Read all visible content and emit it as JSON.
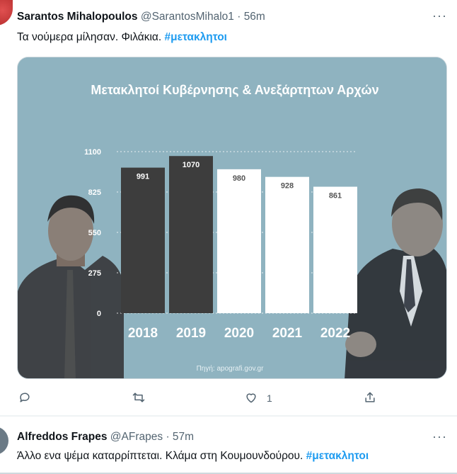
{
  "tweet1": {
    "author": "Sarantos Mihalopoulos",
    "handle": "@SarantosMihalo1",
    "separator": "·",
    "time": "56m",
    "text": "Τα νούμερα μίλησαν. Φιλάκια.",
    "hashtag": "#μετακλητοι",
    "more": "···",
    "likes": "1",
    "icons": [
      "reply-icon",
      "retweet-icon",
      "like-icon",
      "share-icon"
    ]
  },
  "tweet2": {
    "author": "Alfreddos Frapes",
    "handle": "@AFrapes",
    "separator": "·",
    "time": "57m",
    "text": "Άλλο ενα ψέμα καταρρίπτεται. Κλάμα στη Κουμουνδούρου.",
    "hashtag": "#μετακλητοι",
    "more": "···"
  },
  "colors": {
    "accent": "#1d9bf0",
    "chart_bg": "#8fb3c0",
    "bar_dark": "#3d3d3d",
    "bar_light": "#ffffff"
  },
  "chart_data": {
    "type": "bar",
    "title": "Μετακλητοί Κυβέρνησης & Ανεξάρτητων Αρχών",
    "categories": [
      "2018",
      "2019",
      "2020",
      "2021",
      "2022"
    ],
    "values": [
      991,
      1070,
      980,
      928,
      861
    ],
    "bar_colors": [
      "#3d3d3d",
      "#3d3d3d",
      "#ffffff",
      "#ffffff",
      "#ffffff"
    ],
    "yticks": [
      "0",
      "275",
      "550",
      "825",
      "1100"
    ],
    "ylim": [
      0,
      1100
    ],
    "grid": true,
    "source": "Πηγή: apografi.gov.gr"
  }
}
